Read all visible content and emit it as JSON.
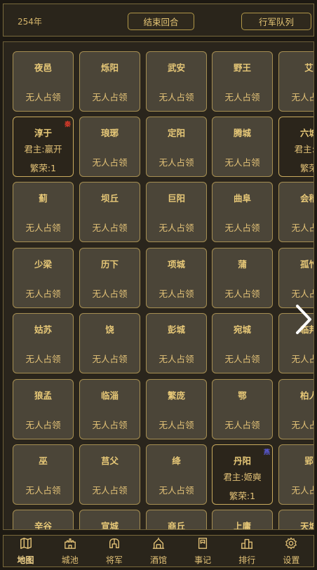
{
  "header": {
    "year": "254年",
    "end_turn_label": "结束回合",
    "march_queue_label": "行军队列"
  },
  "colors": {
    "qin_badge": "#d83a2a",
    "other_badge": "#5a5ad8",
    "gold": "#e3c277"
  },
  "grid": {
    "rows": [
      [
        {
          "name": "夜邑",
          "status": "无人占领"
        },
        {
          "name": "烁阳",
          "status": "无人占领"
        },
        {
          "name": "武安",
          "status": "无人占领"
        },
        {
          "name": "野王",
          "status": "无人占领"
        },
        {
          "name": "艾",
          "status": "无人占领"
        }
      ],
      [
        {
          "name": "淳于",
          "lord": "君主:嬴开",
          "prosperity": "繁荣:1",
          "badge": "秦",
          "badge_color": "#d83a2a"
        },
        {
          "name": "琅琊",
          "status": "无人占领"
        },
        {
          "name": "定阳",
          "status": "无人占领"
        },
        {
          "name": "腾城",
          "status": "无人占领"
        },
        {
          "name": "六城",
          "lord": "君主:嬴",
          "prosperity": "繁荣"
        }
      ],
      [
        {
          "name": "蓟",
          "status": "无人占领"
        },
        {
          "name": "坝丘",
          "status": "无人占领"
        },
        {
          "name": "巨阳",
          "status": "无人占领"
        },
        {
          "name": "曲阜",
          "status": "无人占领"
        },
        {
          "name": "会稽",
          "status": "无人占领"
        }
      ],
      [
        {
          "name": "少梁",
          "status": "无人占领"
        },
        {
          "name": "历下",
          "status": "无人占领"
        },
        {
          "name": "项城",
          "status": "无人占领"
        },
        {
          "name": "蒲",
          "status": "无人占领"
        },
        {
          "name": "孤竹",
          "status": "无人占领"
        }
      ],
      [
        {
          "name": "姑苏",
          "status": "无人占领"
        },
        {
          "name": "饶",
          "status": "无人占领"
        },
        {
          "name": "彭城",
          "status": "无人占领"
        },
        {
          "name": "宛城",
          "status": "无人占领"
        },
        {
          "name": "临邦",
          "status": "无人占领"
        }
      ],
      [
        {
          "name": "狼孟",
          "status": "无人占领"
        },
        {
          "name": "临淄",
          "status": "无人占领"
        },
        {
          "name": "繁庞",
          "status": "无人占领"
        },
        {
          "name": "鄂",
          "status": "无人占领"
        },
        {
          "name": "柏人",
          "status": "无人占领"
        }
      ],
      [
        {
          "name": "巫",
          "status": "无人占领"
        },
        {
          "name": "莒父",
          "status": "无人占领"
        },
        {
          "name": "绛",
          "status": "无人占领"
        },
        {
          "name": "丹阳",
          "lord": "君主:姬奭",
          "prosperity": "繁荣:1",
          "badge": "燕",
          "badge_color": "#5a5ad8"
        },
        {
          "name": "郢",
          "status": "无人占领"
        }
      ],
      [
        {
          "name": "辛谷",
          "status": ""
        },
        {
          "name": "宣城",
          "status": ""
        },
        {
          "name": "商丘",
          "status": ""
        },
        {
          "name": "上庸",
          "status": ""
        },
        {
          "name": "天城",
          "status": ""
        }
      ]
    ]
  },
  "nav": {
    "items": [
      {
        "label": "地图",
        "icon": "map-icon",
        "active": true
      },
      {
        "label": "城池",
        "icon": "castle-icon"
      },
      {
        "label": "将军",
        "icon": "helmet-icon"
      },
      {
        "label": "酒馆",
        "icon": "tavern-icon"
      },
      {
        "label": "事记",
        "icon": "book-icon"
      },
      {
        "label": "排行",
        "icon": "ranking-icon"
      },
      {
        "label": "设置",
        "icon": "gear-icon"
      }
    ]
  }
}
